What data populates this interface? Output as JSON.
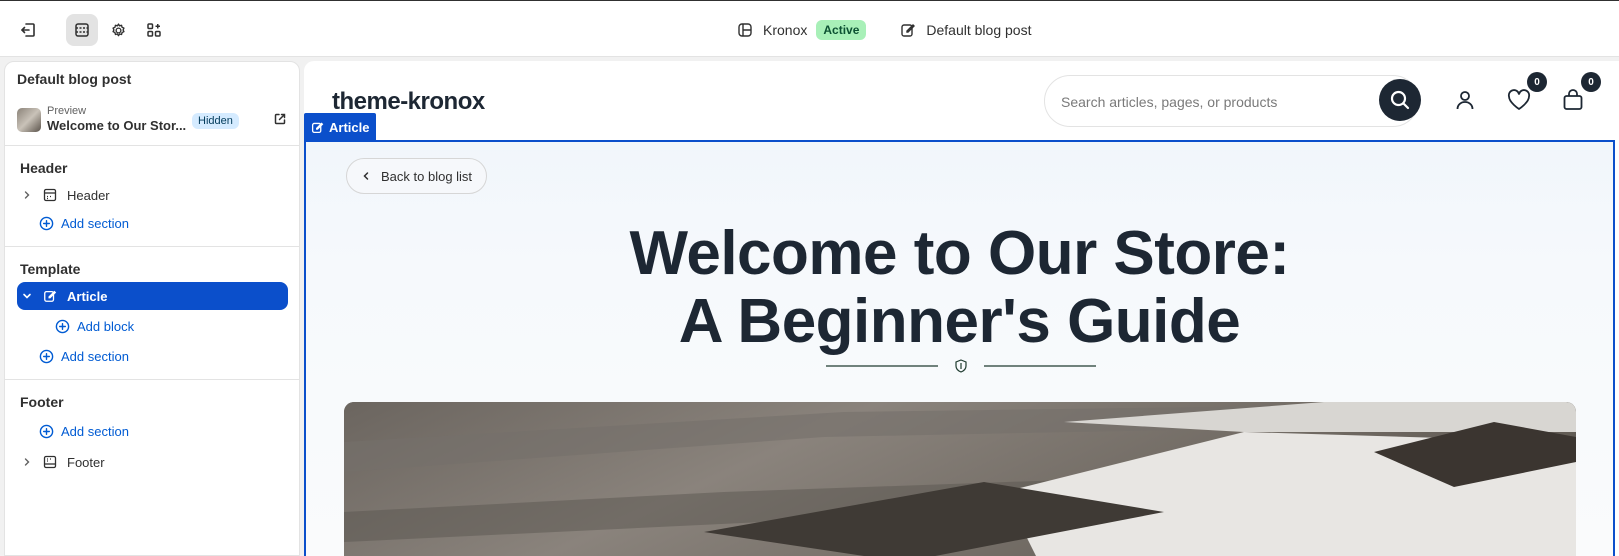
{
  "topbar": {
    "theme_name": "Kronox",
    "theme_status": "Active",
    "template_name": "Default blog post"
  },
  "panel": {
    "title": "Default blog post",
    "preview": {
      "small_label": "Preview",
      "item_name": "Welcome to Our Stor...",
      "status": "Hidden"
    },
    "groups": {
      "header": {
        "title": "Header",
        "section_label": "Header",
        "add_section": "Add section"
      },
      "template": {
        "title": "Template",
        "section_label": "Article",
        "add_block": "Add block",
        "add_section": "Add section"
      },
      "footer": {
        "title": "Footer",
        "add_section": "Add section",
        "section_label": "Footer"
      }
    }
  },
  "store": {
    "logo": "theme-kronox",
    "search_placeholder": "Search articles, pages, or products",
    "wishlist_count": "0",
    "cart_count": "0",
    "article_tag": "Article",
    "back_label": "Back to blog list",
    "title_line1": "Welcome to Our Store:",
    "title_line2": "A Beginner's Guide"
  },
  "colors": {
    "accent": "#0b4fcb",
    "active_badge": "#a8f0b8",
    "hidden_badge": "#d5ebff",
    "store_dark": "#1d2733"
  }
}
